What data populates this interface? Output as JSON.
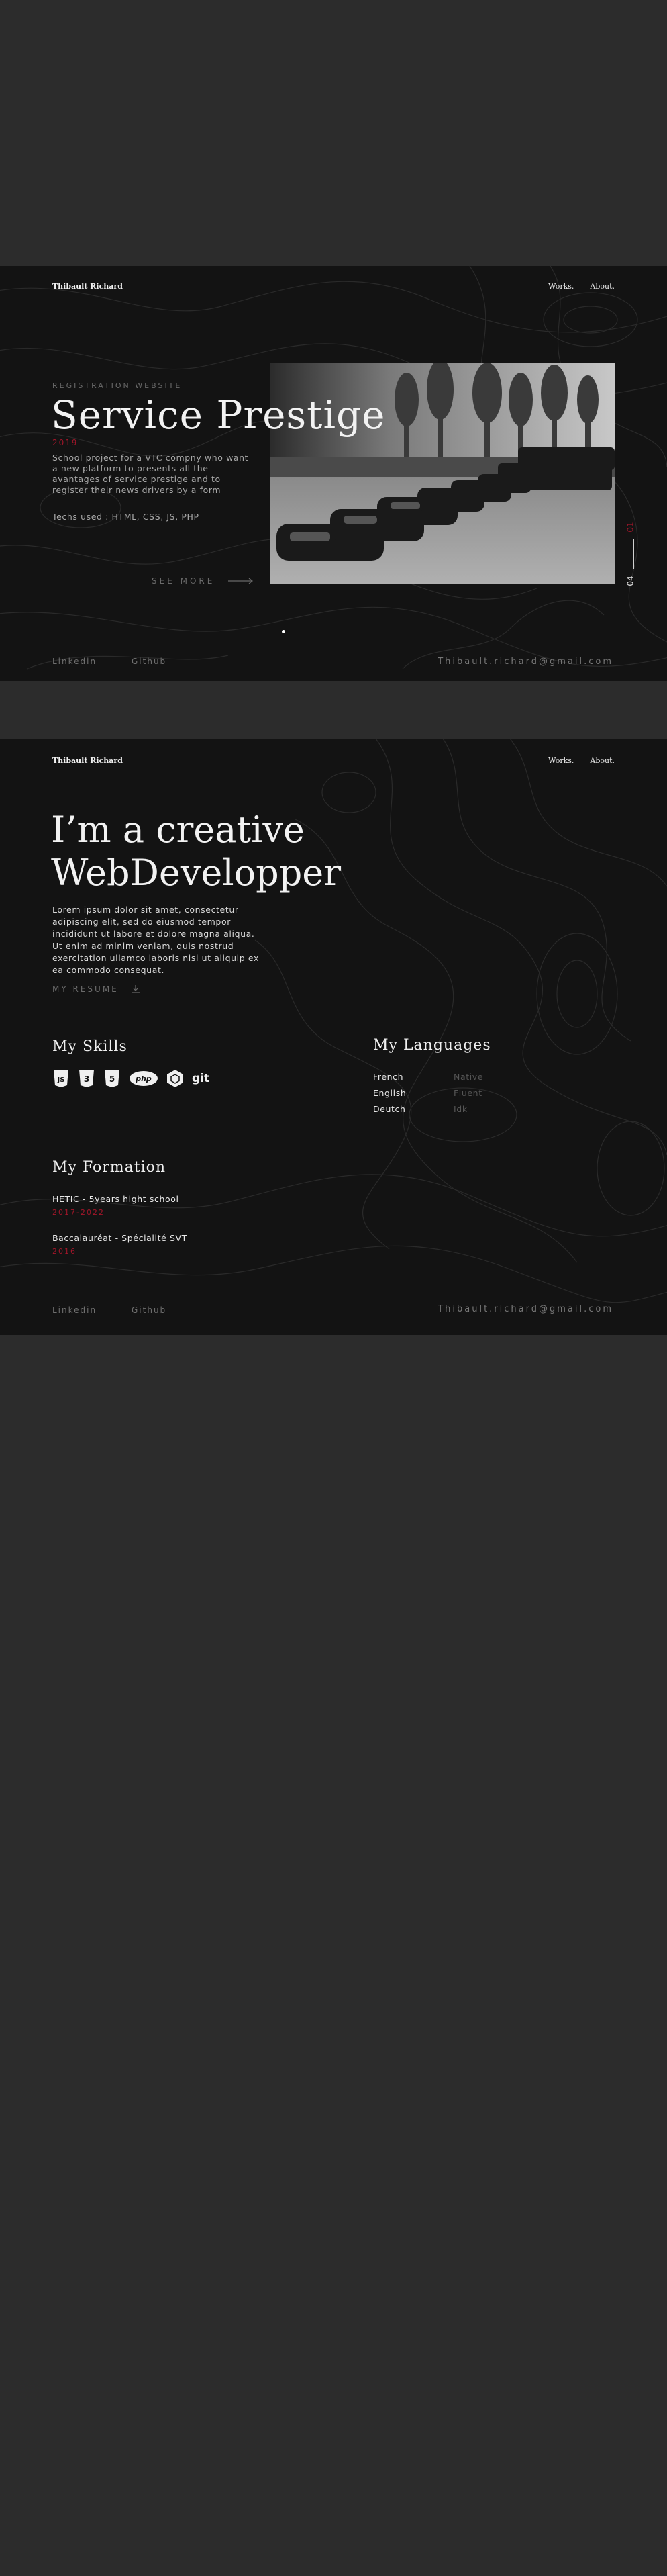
{
  "common": {
    "brand": "Thibault Richard",
    "nav": [
      "Works.",
      "About."
    ],
    "footer_links": [
      "Linkedin",
      "Github"
    ],
    "email": "Thibault.richard@gmail.com"
  },
  "work": {
    "category": "REGISTRATION WEBSITE",
    "title": "Service Prestige",
    "year": "2019",
    "description": [
      "School project for a VTC compny who want",
      "a new platform to presents all the",
      "avantages of service prestige and to",
      "register their news drivers by a form"
    ],
    "techs": "Techs used : HTML, CSS, JS, PHP",
    "see_more": "SEE MORE",
    "counter_current": "01",
    "counter_total": "04",
    "colors": {
      "accent": "#a3162a",
      "background": "#131313"
    }
  },
  "about": {
    "headline_1": "I’m a creative",
    "headline_2": "WebDevelopper",
    "lorem": [
      "Lorem ipsum dolor sit amet, consectetur",
      "adipiscing elit, sed do eiusmod tempor",
      "incididunt ut labore et dolore magna aliqua.",
      "Ut enim ad minim veniam, quis nostrud",
      "exercitation ullamco laboris nisi ut aliquip ex",
      "ea commodo consequat."
    ],
    "resume_label": "MY RESUME",
    "skills_title": "My Skills",
    "skills_icons": [
      "js-icon",
      "css3-icon",
      "html5-icon",
      "php-icon",
      "hexagon-icon",
      "git-icon"
    ],
    "skills_text": {
      "php": "php",
      "git": "git"
    },
    "languages_title": "My Languages",
    "languages": [
      {
        "name": "French",
        "level": "Native"
      },
      {
        "name": "English",
        "level": "Fluent"
      },
      {
        "name": "Deutch",
        "level": "Idk"
      }
    ],
    "formation_title": "My Formation",
    "formation": [
      {
        "name": "HETIC - 5years hight school",
        "years": "2017-2022"
      },
      {
        "name": "Baccalauréat - Spécialité SVT",
        "years": "2016"
      }
    ]
  }
}
